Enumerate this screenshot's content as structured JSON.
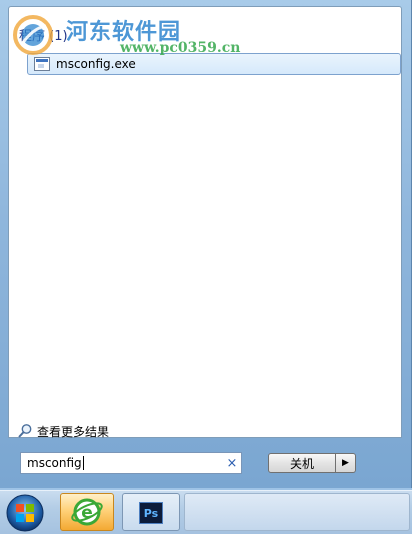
{
  "search_results": {
    "section_header": "程序 (1)",
    "items": [
      {
        "label": "msconfig.exe",
        "icon": "application-icon"
      }
    ]
  },
  "watermark": {
    "text": "河东软件园",
    "url": "www.pc0359.cn"
  },
  "more_results": {
    "label": "查看更多结果",
    "icon": "magnifier-icon"
  },
  "search_box": {
    "value": "msconfig",
    "clear_icon": "×"
  },
  "shutdown": {
    "label": "关机",
    "arrow": "▶"
  },
  "taskbar": {
    "items": [
      {
        "name": "start-orb",
        "icon": "windows-logo"
      },
      {
        "name": "internet-explorer",
        "icon": "ie-icon"
      },
      {
        "name": "photoshop",
        "icon": "ps-icon",
        "label": "Ps"
      }
    ]
  },
  "colors": {
    "header_text": "#1e3287",
    "selection_border": "#7da2ce",
    "watermark_blue": "#2f86cf",
    "watermark_green": "#36a84d"
  }
}
